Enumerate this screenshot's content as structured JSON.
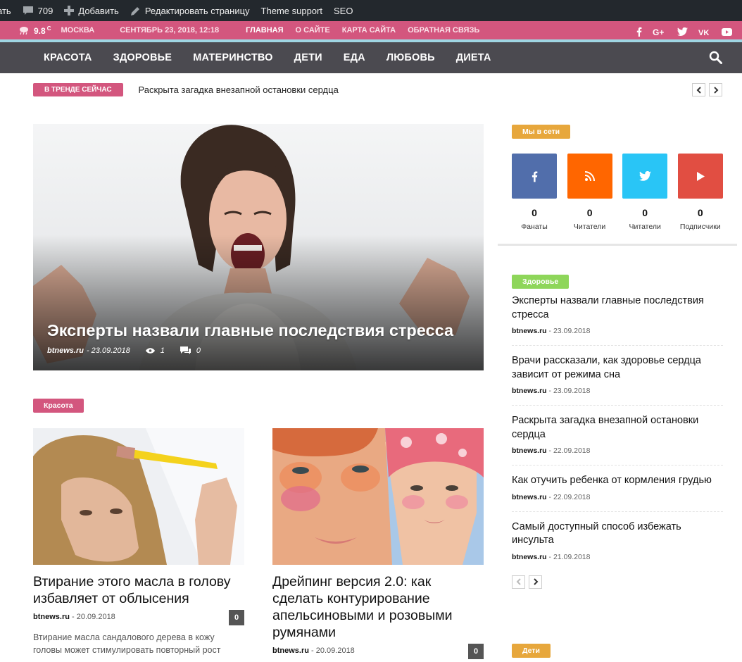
{
  "adminbar": {
    "cut_text": "ать",
    "comments": "709",
    "add": "Добавить",
    "edit": "Редактировать страницу",
    "theme": "Theme support",
    "seo": "SEO"
  },
  "topbar": {
    "temp": "9.8",
    "deg": "C",
    "city": "МОСКВА",
    "date": "СЕНТЯБРЬ 23, 2018, 12:18",
    "menu": [
      "ГЛАВНАЯ",
      "О САЙТЕ",
      "КАРТА САЙТА",
      "ОБРАТНАЯ СВЯЗЬ"
    ]
  },
  "nav": [
    "КРАСОТА",
    "ЗДОРОВЬЕ",
    "МАТЕРИНСТВО",
    "ДЕТИ",
    "ЕДА",
    "ЛЮБОВЬ",
    "ДИЕТА"
  ],
  "trending": {
    "label": "В ТРЕНДЕ СЕЙЧАС",
    "text": "Раскрыта загадка внезапной остановки сердца"
  },
  "hero": {
    "title": "Эксперты назвали главные последствия стресса",
    "author": "btnews.ru",
    "date": "- 23.09.2018",
    "views": "1",
    "comments": "0"
  },
  "beauty": {
    "label": "Красота",
    "cards": [
      {
        "title": "Втирание этого масла в голову избавляет от облысения",
        "author": "btnews.ru",
        "date": "20.09.2018",
        "count": "0",
        "excerpt": "Втирание масла сандалового дерева в кожу головы может стимулировать повторный рост"
      },
      {
        "title": "Дрейпинг версия 2.0: как сделать контурирование апельсиновыми и розовыми румянами",
        "author": "btnews.ru",
        "date": "20.09.2018",
        "count": "0"
      }
    ]
  },
  "sidebar": {
    "online_label": "Мы в сети",
    "social": [
      {
        "icon": "facebook-icon",
        "count": "0",
        "label": "Фанаты",
        "color": "#516eab"
      },
      {
        "icon": "rss-icon",
        "count": "0",
        "label": "Читатели",
        "color": "#ff6600"
      },
      {
        "icon": "twitter-icon",
        "count": "0",
        "label": "Читатели",
        "color": "#29c5f6"
      },
      {
        "icon": "youtube-icon",
        "count": "0",
        "label": "Подписчики",
        "color": "#e14e42"
      }
    ],
    "health_label": "Здоровье",
    "news": [
      {
        "title": "Эксперты назвали главные последствия стресса",
        "author": "btnews.ru",
        "date": "23.09.2018"
      },
      {
        "title": "Врачи рассказали, как здоровье сердца зависит от режима сна",
        "author": "btnews.ru",
        "date": "23.09.2018"
      },
      {
        "title": "Раскрыта загадка внезапной остановки сердца",
        "author": "btnews.ru",
        "date": "22.09.2018"
      },
      {
        "title": "Как отучить ребенка от кормления грудью",
        "author": "btnews.ru",
        "date": "22.09.2018"
      },
      {
        "title": "Самый доступный способ избежать инсульта",
        "author": "btnews.ru",
        "date": "21.09.2018"
      }
    ],
    "kids_label": "Дети"
  },
  "colors": {
    "brand_pink": "#d3567e",
    "nav_bg": "#4b4a50",
    "orange_badge": "#e7a73c",
    "green_badge": "#8ed65a"
  }
}
